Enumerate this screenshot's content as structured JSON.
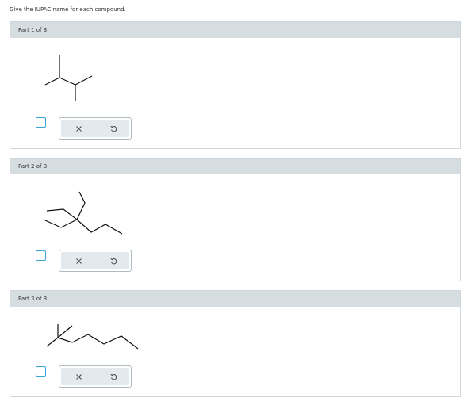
{
  "instructions": "Give the IUPAC name for each compound.",
  "parts": [
    {
      "title": "Part 1 of 3",
      "molecule": "skeletal-structure"
    },
    {
      "title": "Part 2 of 3",
      "molecule": "skeletal-structure"
    },
    {
      "title": "Part 3 of 3",
      "molecule": "skeletal-structure"
    }
  ],
  "icons": {
    "clear": "x-icon",
    "undo": "undo-icon"
  },
  "colors": {
    "header_bg": "#d5dde1",
    "checkbox_border": "#36a3d9",
    "tool_bg": "#e3eaee"
  }
}
